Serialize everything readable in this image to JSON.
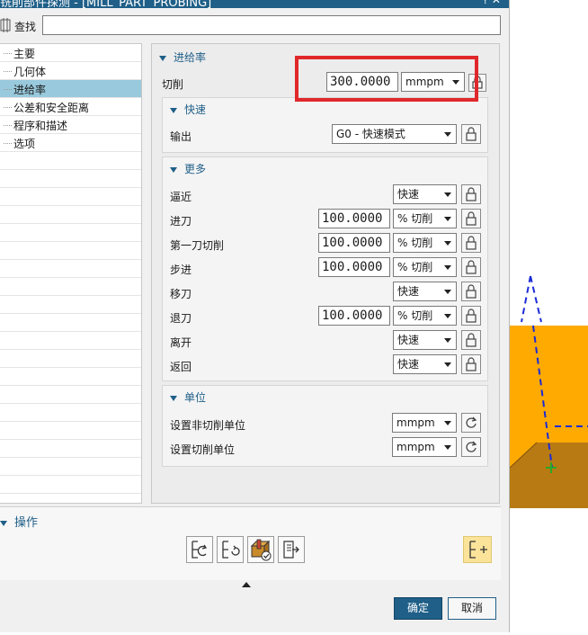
{
  "window": {
    "title": "铣削部件探测 - [MILL_PART_PROBING]"
  },
  "search": {
    "label": "查找",
    "value": ""
  },
  "tree": {
    "items": [
      {
        "label": "主要",
        "selected": false
      },
      {
        "label": "几何体",
        "selected": false
      },
      {
        "label": "进给率",
        "selected": true
      },
      {
        "label": "公差和安全距离",
        "selected": false
      },
      {
        "label": "程序和描述",
        "selected": false
      },
      {
        "label": "选项",
        "selected": false
      }
    ]
  },
  "feedrate": {
    "header": "进给率",
    "cut": {
      "label": "切削",
      "value": "300.0000",
      "unit": "mmpm"
    },
    "rapid": {
      "header": "快速",
      "output_label": "输出",
      "output_value": "G0 - 快速模式"
    },
    "more": {
      "header": "更多",
      "rows": [
        {
          "label": "逼近",
          "value": "",
          "unit": "快速"
        },
        {
          "label": "进刀",
          "value": "100.0000",
          "unit": "% 切削"
        },
        {
          "label": "第一刀切削",
          "value": "100.0000",
          "unit": "% 切削"
        },
        {
          "label": "步进",
          "value": "100.0000",
          "unit": "% 切削"
        },
        {
          "label": "移刀",
          "value": "",
          "unit": "快速"
        },
        {
          "label": "退刀",
          "value": "100.0000",
          "unit": "% 切削"
        },
        {
          "label": "离开",
          "value": "",
          "unit": "快速"
        },
        {
          "label": "返回",
          "value": "",
          "unit": "快速"
        }
      ]
    },
    "units": {
      "header": "单位",
      "noncut_label": "设置非切削单位",
      "noncut_value": "mmpm",
      "cut_label": "设置切削单位",
      "cut_value": "mmpm"
    }
  },
  "operations": {
    "header": "操作"
  },
  "footer": {
    "ok_label": "确定",
    "cancel_label": "取消"
  },
  "colors": {
    "accent": "#1f5f88",
    "selected_row": "#99c9dc",
    "highlight": "#e0282b",
    "part_top": "#ffaa00",
    "part_side": "#b87a12"
  }
}
